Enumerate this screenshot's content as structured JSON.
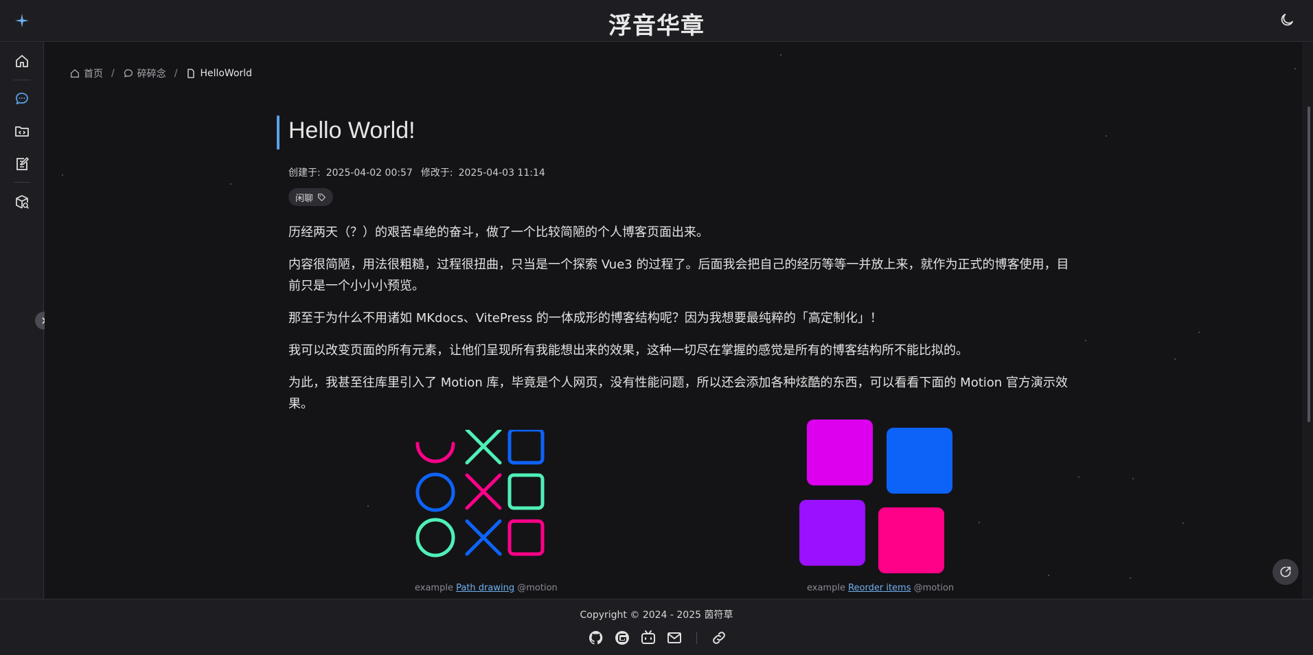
{
  "header": {
    "site_title": "浮音华章",
    "logo_icon": "sparkle-icon",
    "theme_icon": "moon-icon"
  },
  "sidebar": {
    "items": [
      {
        "name": "home",
        "icon": "home-icon"
      },
      {
        "name": "chat",
        "icon": "chat-bubble-icon",
        "active": true
      },
      {
        "name": "code-folder",
        "icon": "code-folder-icon"
      },
      {
        "name": "notes",
        "icon": "edit-note-icon"
      },
      {
        "name": "package-search",
        "icon": "package-search-icon"
      }
    ],
    "collapse_icon": "chevron-right-icon"
  },
  "breadcrumb": {
    "home": "首页",
    "section": "碎碎念",
    "current": "HelloWorld",
    "separator": "/"
  },
  "article": {
    "title": "Hello World!",
    "created_label": "创建于:",
    "created_value": "2025-04-02 00:57",
    "modified_label": "修改于:",
    "modified_value": "2025-04-03 11:14",
    "tag": "闲聊",
    "paragraphs": [
      "历经两天（？）的艰苦卓绝的奋斗，做了一个比较简陋的个人博客页面出来。",
      "内容很简陋，用法很粗糙，过程很扭曲，只当是一个探索 Vue3 的过程了。后面我会把自己的经历等等一并放上来，就作为正式的博客使用，目前只是一个小小小预览。",
      "那至于为什么不用诸如 MKdocs、VitePress 的一体成形的博客结构呢？因为我想要最纯粹的「高定制化」！",
      "我可以改变页面的所有元素，让他们呈现所有我能想出来的效果，这种一切尽在掌握的感觉是所有的博客结构所不能比拟的。",
      "为此，我甚至往库里引入了 Motion 库，毕竟是个人网页，没有性能问题，所以还会添加各种炫酷的东西，可以看看下面的 Motion 官方演示效果。"
    ]
  },
  "demos": [
    {
      "prefix": "example",
      "link": "Path drawing",
      "suffix": "@motion"
    },
    {
      "prefix": "example",
      "link": "Reorder items",
      "suffix": "@motion"
    }
  ],
  "colors": {
    "accent": "#5aa0e8",
    "pink": "#ff0088",
    "magenta": "#dd00ee",
    "blue": "#0d63f8",
    "purple": "#9911ff",
    "green": "#4ff0b7",
    "link": "#6fb2f0"
  },
  "footer": {
    "copyright": "Copyright © 2024 - 2025 茵符草",
    "social_icons": [
      "github-icon",
      "gitee-icon",
      "bilibili-icon",
      "mail-icon",
      "link-icon"
    ]
  }
}
